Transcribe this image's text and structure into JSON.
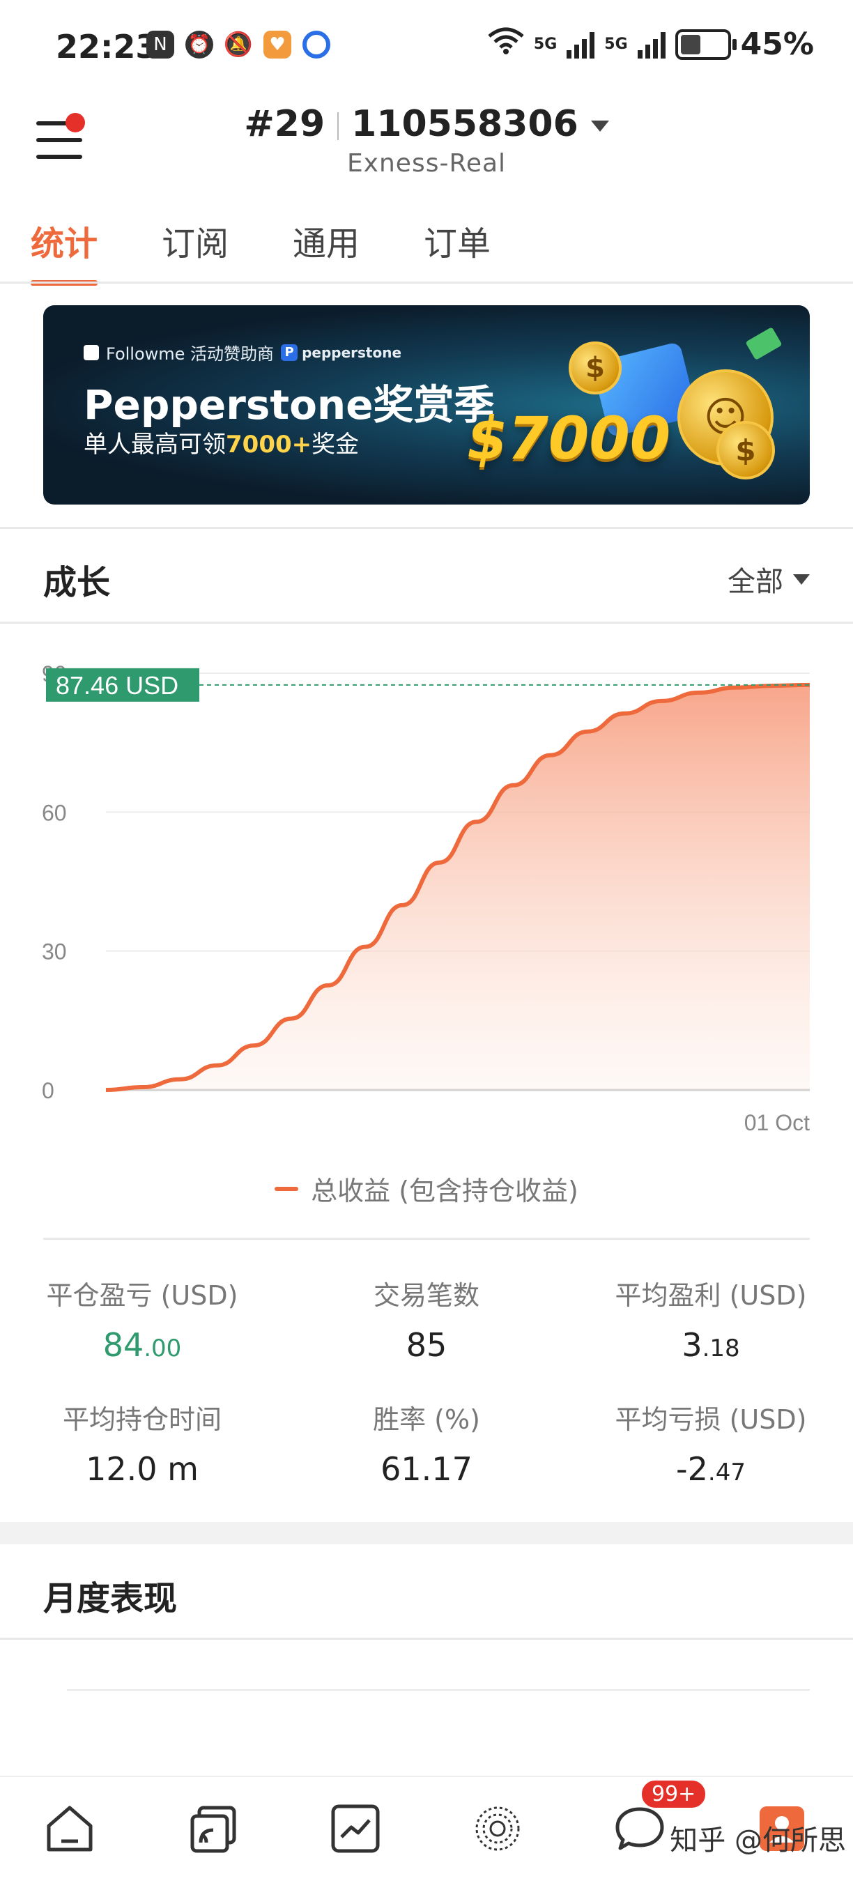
{
  "status_bar": {
    "time": "22:23",
    "network_a": "5G",
    "network_b": "5G",
    "battery": "45%",
    "battery_fraction": 0.45
  },
  "header": {
    "account_index": "#29",
    "account_number": "110558306",
    "server": "Exness-Real"
  },
  "tabs": [
    "统计",
    "订阅",
    "通用",
    "订单"
  ],
  "banner": {
    "sponsor_text": "Followme 活动赞助商",
    "brand": "pepperstone",
    "title": "Pepperstone奖赏季",
    "sub_prefix": "单人最高可领",
    "sub_highlight": "7000+",
    "sub_suffix": "奖金",
    "amount": "$7000"
  },
  "growth": {
    "title": "成长",
    "filter_label": "全部"
  },
  "chart_data": {
    "type": "area",
    "current_value_label": "87.46 USD",
    "current_value": 87.46,
    "y_ticks": [
      "90",
      "60",
      "30",
      "0"
    ],
    "ylim": [
      0,
      90
    ],
    "x_label": "01 Oct",
    "series": [
      {
        "name": "总收益 (包含持仓收益)",
        "color": "#ee6a3c",
        "values": [
          0,
          0.6,
          2.3,
          5.3,
          9.6,
          15.4,
          22.6,
          30.9,
          39.9,
          49.1,
          57.9,
          65.8,
          72.3,
          77.4,
          81.3,
          84.0,
          85.8,
          86.9,
          87.3,
          87.46
        ]
      }
    ],
    "grid": true
  },
  "legend": {
    "label": "总收益 (包含持仓收益)"
  },
  "stats": [
    {
      "label": "平仓盈亏 (USD)",
      "int": "84",
      "dec": ".00",
      "color": "#2e9a6e"
    },
    {
      "label": "交易笔数",
      "int": "85",
      "dec": "",
      "color": "#222222"
    },
    {
      "label": "平均盈利 (USD)",
      "int": "3",
      "dec": ".18",
      "color": "#222222"
    },
    {
      "label": "平均持仓时间",
      "int": "12.0 m",
      "dec": "",
      "color": "#222222"
    },
    {
      "label": "胜率 (%)",
      "int": "61.17",
      "dec": "",
      "color": "#222222"
    },
    {
      "label": "平均亏损 (USD)",
      "int": "-2",
      "dec": ".47",
      "color": "#222222"
    }
  ],
  "monthly": {
    "title": "月度表现"
  },
  "bottom_nav": {
    "items": [
      "home-icon",
      "copy-trading-icon",
      "chart-icon",
      "discover-icon",
      "message-icon",
      "profile-icon"
    ],
    "message_badge": "99+"
  },
  "watermark": "知乎 @何所思"
}
